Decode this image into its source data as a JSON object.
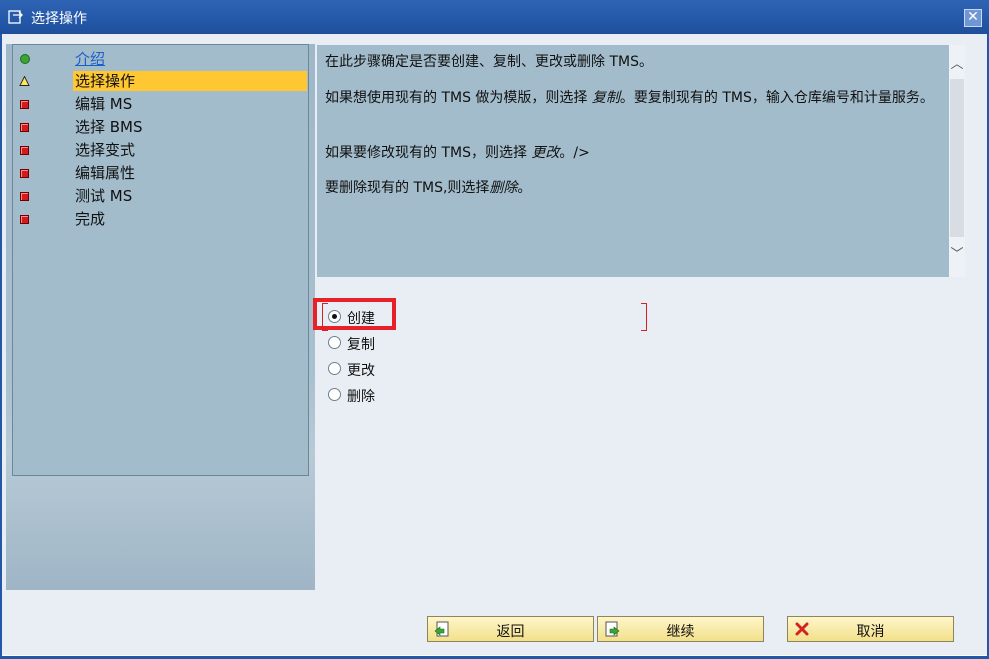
{
  "window": {
    "title": "选择操作"
  },
  "steps": [
    {
      "label": "介绍",
      "status": "done",
      "icon": "green-dot-icon"
    },
    {
      "label": "选择操作",
      "status": "current",
      "icon": "warning-triangle-icon"
    },
    {
      "label": "编辑 MS",
      "status": "pending",
      "icon": "red-square-icon"
    },
    {
      "label": "选择 BMS",
      "status": "pending",
      "icon": "red-square-icon"
    },
    {
      "label": "选择变式",
      "status": "pending",
      "icon": "red-square-icon"
    },
    {
      "label": "编辑属性",
      "status": "pending",
      "icon": "red-square-icon"
    },
    {
      "label": "测试 MS",
      "status": "pending",
      "icon": "red-square-icon"
    },
    {
      "label": "完成",
      "status": "pending",
      "icon": "red-square-icon"
    }
  ],
  "info": {
    "p1": "在此步骤确定是否要创建、复制、更改或删除 TMS。",
    "p2_pre": "如果想使用现有的 TMS 做为模版，则选择 ",
    "p2_em": "复制",
    "p2_post": "。要复制现有的 TMS，输入仓库编号和计量服务。",
    "p3_pre": "如果要修改现有的 TMS，则选择 ",
    "p3_em": "更改",
    "p3_post": "。/>",
    "p4_pre": "要删除现有的 TMS,则选择",
    "p4_em": "删除",
    "p4_post": "。"
  },
  "options": [
    {
      "label": "创建",
      "checked": true
    },
    {
      "label": "复制",
      "checked": false
    },
    {
      "label": "更改",
      "checked": false
    },
    {
      "label": "删除",
      "checked": false
    }
  ],
  "buttons": {
    "back": "返回",
    "continue": "继续",
    "cancel": "取消"
  },
  "colors": {
    "titlebar": "#2358a8",
    "current_step": "#ffc832",
    "highlight": "#e8202a",
    "button_bg": "#f2e08a"
  }
}
